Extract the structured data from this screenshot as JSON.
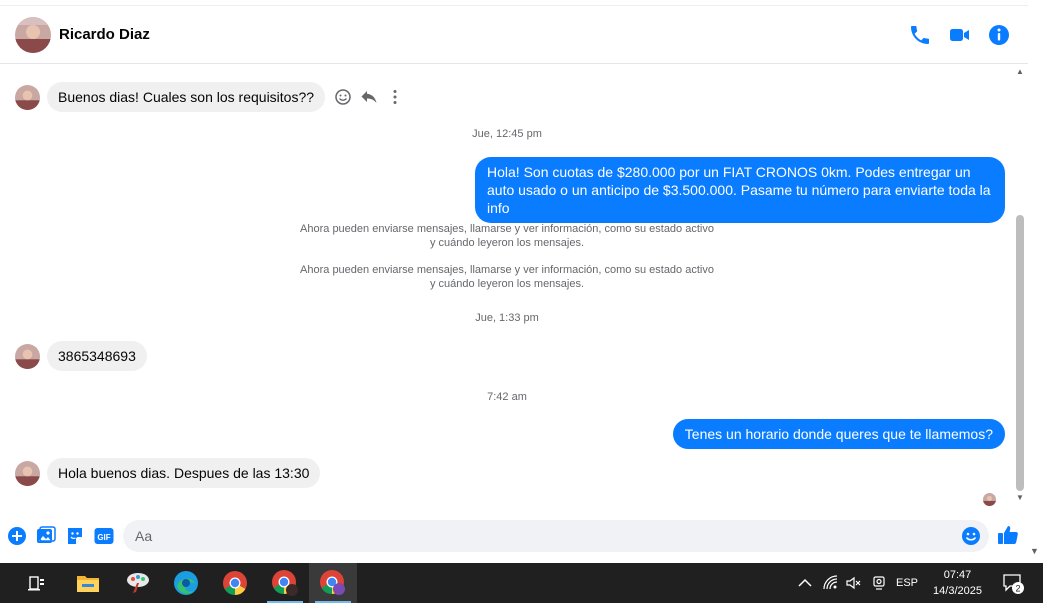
{
  "contact": {
    "name": "Ricardo Diaz"
  },
  "colors": {
    "accent": "#0a7cff",
    "incoming_bg": "#f0f0f0",
    "taskbar": "#202020"
  },
  "header_icons": [
    "phone-icon",
    "video-camera-icon",
    "info-icon"
  ],
  "messages": {
    "m1": "Buenos dias! Cuales son los requisitos??",
    "ts1": "Jue, 12:45 pm",
    "m2": "Hola! Son cuotas de $280.000 por un FIAT CRONOS 0km. Podes entregar un auto usado o un anticipo de $3.500.000. Pasame tu número para enviarte toda la info",
    "sys1_line1": "Ahora pueden enviarse mensajes, llamarse y ver información, como su estado activo",
    "sys1_line2": "y cuándo leyeron los mensajes.",
    "sys2_line1": "Ahora pueden enviarse mensajes, llamarse y ver información, como su estado activo",
    "sys2_line2": "y cuándo leyeron los mensajes.",
    "ts2": "Jue, 1:33 pm",
    "m3": "3865348693",
    "ts3": "7:42 am",
    "m4": "Tenes un horario donde queres que te llamemos?",
    "m5": "Hola buenos dias. Despues de las 13:30"
  },
  "message_actions": [
    "emoji-react-icon",
    "reply-icon",
    "more-options-icon"
  ],
  "composer": {
    "placeholder": "Aa",
    "icons": [
      "plus-icon",
      "image-icon",
      "sticker-icon",
      "gif-icon",
      "emoji-icon",
      "like-icon"
    ],
    "gif_label": "GIF"
  },
  "taskbar": {
    "apps": [
      "task-view-icon",
      "file-explorer-icon",
      "paint-icon",
      "edge-icon",
      "chrome-icon",
      "chrome-profile-icon",
      "chrome-incognito-icon"
    ],
    "tray": {
      "language": "ESP",
      "time": "07:47",
      "date": "14/3/2025",
      "notifications": "2"
    }
  }
}
